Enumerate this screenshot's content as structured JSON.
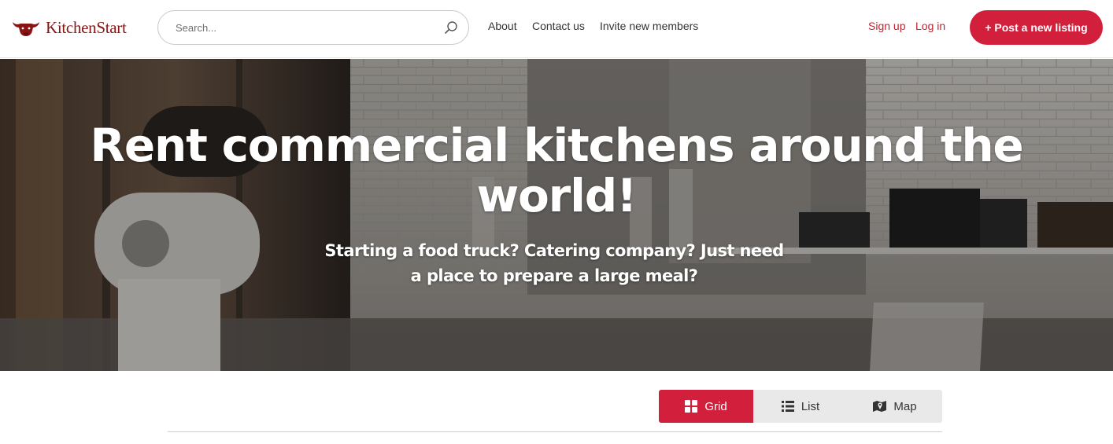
{
  "header": {
    "logo_text": "KitchenStart",
    "search_placeholder": "Search...",
    "nav": [
      "About",
      "Contact us",
      "Invite new members"
    ],
    "signup_label": "Sign up",
    "login_label": "Log in",
    "post_button_label": "+ Post a new listing"
  },
  "hero": {
    "title": "Rent commercial kitchens around the world!",
    "subtitle": "Starting a food truck? Catering company? Just need a place to prepare a large meal?"
  },
  "view_toggle": {
    "options": [
      {
        "label": "Grid",
        "icon": "grid-icon",
        "active": true
      },
      {
        "label": "List",
        "icon": "list-icon",
        "active": false
      },
      {
        "label": "Map",
        "icon": "map-icon",
        "active": false
      }
    ]
  },
  "colors": {
    "brand_red": "#d21f3c",
    "link_red": "#c5212f",
    "logo_red": "#8a1414"
  }
}
